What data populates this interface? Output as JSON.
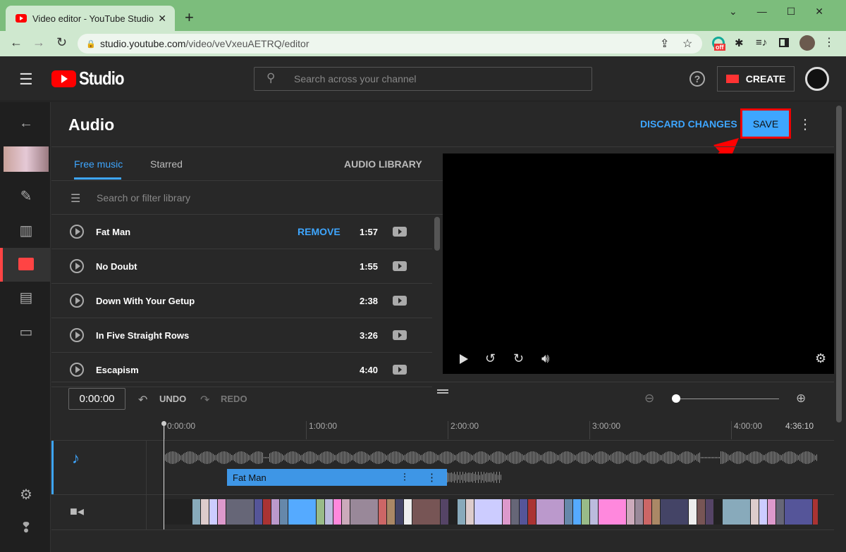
{
  "browser": {
    "tab_title": "Video editor - YouTube Studio",
    "url_host": "studio.youtube.com",
    "url_path": "/video/veVxeuAETRQ/editor",
    "ext_badge": "off"
  },
  "header": {
    "logo": "Studio",
    "search_placeholder": "Search across your channel",
    "create_label": "CREATE"
  },
  "page": {
    "title": "Audio",
    "discard_label": "DISCARD CHANGES",
    "save_label": "SAVE"
  },
  "library": {
    "tabs": [
      {
        "label": "Free music",
        "active": true
      },
      {
        "label": "Starred"
      }
    ],
    "audio_library_label": "AUDIO LIBRARY",
    "filter_placeholder": "Search or filter library",
    "tracks": [
      {
        "title": "Fat Man",
        "duration": "1:57",
        "action": "REMOVE"
      },
      {
        "title": "No Doubt",
        "duration": "1:55"
      },
      {
        "title": "Down With Your Getup",
        "duration": "2:38"
      },
      {
        "title": "In Five Straight Rows",
        "duration": "3:26"
      },
      {
        "title": "Escapism",
        "duration": "4:40"
      }
    ]
  },
  "timeline": {
    "current_time": "0:00:00",
    "undo_label": "UNDO",
    "redo_label": "REDO",
    "ticks": [
      "0:00:00",
      "1:00:00",
      "2:00:00",
      "3:00:00",
      "4:00:00"
    ],
    "end_time": "4:36:10",
    "clip_label": "Fat Man",
    "zoom_level": 0
  },
  "colors": {
    "accent": "#3ea6ff",
    "save_highlight": "#ff0000",
    "brand_red": "#ff0000"
  }
}
